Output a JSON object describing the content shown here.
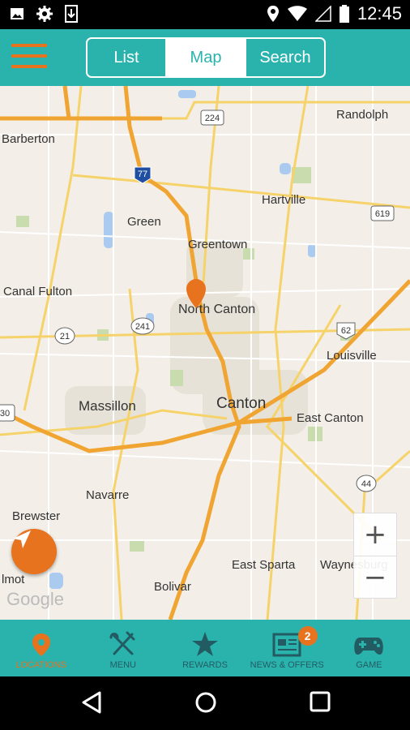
{
  "status": {
    "time": "12:45"
  },
  "header": {
    "segments": [
      {
        "label": "List"
      },
      {
        "label": "Map"
      },
      {
        "label": "Search"
      }
    ]
  },
  "map": {
    "towns": [
      "Barberton",
      "Randolph",
      "Hartville",
      "Green",
      "Greentown",
      "Canal Fulton",
      "North Canton",
      "Louisville",
      "Massillon",
      "Canton",
      "East Canton",
      "Navarre",
      "Brewster",
      "East Sparta",
      "Waynesburg",
      "Bolivar",
      "lmot"
    ],
    "routes": [
      "224",
      "77",
      "619",
      "21",
      "241",
      "62",
      "30",
      "44"
    ],
    "attribution": "Google",
    "zoom_in": "+",
    "zoom_out": "−"
  },
  "tabs": [
    {
      "label": "LOCATIONS",
      "icon": "location-pin-icon"
    },
    {
      "label": "MENU",
      "icon": "fork-knife-icon"
    },
    {
      "label": "REWARDS",
      "icon": "star-icon"
    },
    {
      "label": "NEWS & OFFERS",
      "icon": "newspaper-icon",
      "badge": "2"
    },
    {
      "label": "GAME",
      "icon": "gamepad-icon"
    }
  ],
  "colors": {
    "accent": "#e8731f",
    "teal": "#2ab3ad",
    "tab_text": "#235b63"
  }
}
